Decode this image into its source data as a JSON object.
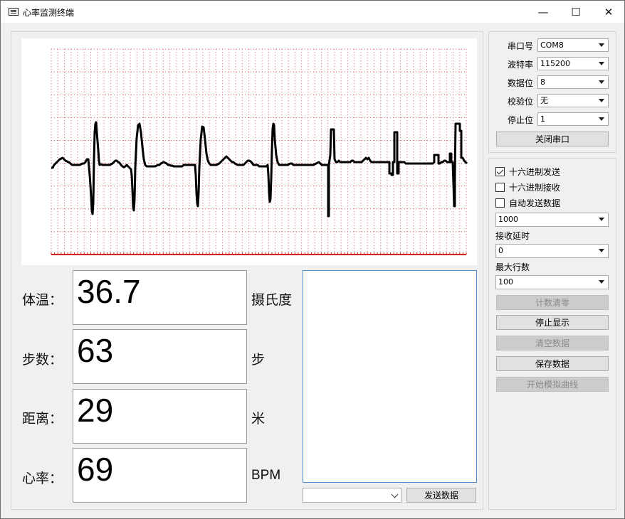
{
  "window": {
    "title": "心率监测终端",
    "minimize_glyph": "—",
    "maximize_glyph": "☐",
    "close_glyph": "✕"
  },
  "plot": {
    "ecg_points": [
      [
        0,
        190
      ],
      [
        2,
        190
      ],
      [
        4,
        186
      ],
      [
        6,
        184
      ],
      [
        8,
        182
      ],
      [
        10,
        180
      ],
      [
        12,
        178
      ],
      [
        14,
        177
      ],
      [
        16,
        176
      ],
      [
        18,
        178
      ],
      [
        20,
        180
      ],
      [
        22,
        181
      ],
      [
        24,
        182
      ],
      [
        26,
        183
      ],
      [
        28,
        185
      ],
      [
        30,
        186
      ],
      [
        32,
        186
      ],
      [
        34,
        186
      ],
      [
        36,
        186
      ],
      [
        38,
        186
      ],
      [
        40,
        186
      ],
      [
        42,
        185
      ],
      [
        44,
        184
      ],
      [
        46,
        184
      ],
      [
        48,
        182
      ],
      [
        50,
        178
      ],
      [
        52,
        178
      ],
      [
        54,
        200
      ],
      [
        56,
        230
      ],
      [
        57,
        250
      ],
      [
        58,
        255
      ],
      [
        59,
        240
      ],
      [
        60,
        180
      ],
      [
        61,
        140
      ],
      [
        62,
        128
      ],
      [
        63,
        126
      ],
      [
        64,
        140
      ],
      [
        66,
        165
      ],
      [
        67,
        180
      ],
      [
        68,
        186
      ],
      [
        70,
        185
      ],
      [
        72,
        186
      ],
      [
        74,
        186
      ],
      [
        76,
        186
      ],
      [
        78,
        186
      ],
      [
        80,
        186
      ],
      [
        82,
        186
      ],
      [
        84,
        185
      ],
      [
        86,
        184
      ],
      [
        88,
        182
      ],
      [
        90,
        180
      ],
      [
        92,
        180
      ],
      [
        94,
        182
      ],
      [
        96,
        183
      ],
      [
        98,
        186
      ],
      [
        100,
        188
      ],
      [
        102,
        189
      ],
      [
        104,
        188
      ],
      [
        106,
        186
      ],
      [
        108,
        188
      ],
      [
        110,
        190
      ],
      [
        112,
        192
      ],
      [
        113,
        200
      ],
      [
        114,
        220
      ],
      [
        115,
        245
      ],
      [
        116,
        250
      ],
      [
        117,
        235
      ],
      [
        118,
        190
      ],
      [
        120,
        148
      ],
      [
        122,
        130
      ],
      [
        124,
        128
      ],
      [
        126,
        140
      ],
      [
        128,
        160
      ],
      [
        130,
        178
      ],
      [
        132,
        186
      ],
      [
        134,
        188
      ],
      [
        136,
        188
      ],
      [
        138,
        188
      ],
      [
        140,
        188
      ],
      [
        142,
        188
      ],
      [
        144,
        188
      ],
      [
        146,
        188
      ],
      [
        148,
        187
      ],
      [
        150,
        186
      ],
      [
        152,
        186
      ],
      [
        154,
        184
      ],
      [
        156,
        183
      ],
      [
        158,
        182
      ],
      [
        160,
        183
      ],
      [
        162,
        184
      ],
      [
        164,
        186
      ],
      [
        166,
        186
      ],
      [
        168,
        187
      ],
      [
        170,
        187
      ],
      [
        172,
        188
      ],
      [
        174,
        188
      ],
      [
        176,
        188
      ],
      [
        178,
        188
      ],
      [
        180,
        188
      ],
      [
        182,
        188
      ],
      [
        184,
        188
      ],
      [
        186,
        186
      ],
      [
        188,
        186
      ],
      [
        190,
        186
      ],
      [
        192,
        186
      ],
      [
        194,
        186
      ],
      [
        196,
        186
      ],
      [
        198,
        186
      ],
      [
        200,
        186
      ],
      [
        202,
        186
      ],
      [
        203,
        200
      ],
      [
        204,
        225
      ],
      [
        205,
        240
      ],
      [
        206,
        244
      ],
      [
        207,
        225
      ],
      [
        208,
        190
      ],
      [
        210,
        150
      ],
      [
        212,
        132
      ],
      [
        214,
        133
      ],
      [
        216,
        150
      ],
      [
        218,
        170
      ],
      [
        220,
        180
      ],
      [
        222,
        184
      ],
      [
        224,
        186
      ],
      [
        226,
        186
      ],
      [
        228,
        186
      ],
      [
        230,
        186
      ],
      [
        232,
        186
      ],
      [
        234,
        185
      ],
      [
        236,
        184
      ],
      [
        238,
        182
      ],
      [
        240,
        180
      ],
      [
        242,
        178
      ],
      [
        244,
        176
      ],
      [
        246,
        174
      ],
      [
        248,
        176
      ],
      [
        250,
        178
      ],
      [
        252,
        180
      ],
      [
        254,
        182
      ],
      [
        256,
        182
      ],
      [
        258,
        184
      ],
      [
        260,
        185
      ],
      [
        262,
        186
      ],
      [
        264,
        186
      ],
      [
        266,
        186
      ],
      [
        268,
        186
      ],
      [
        270,
        186
      ],
      [
        272,
        184
      ],
      [
        274,
        182
      ],
      [
        276,
        180
      ],
      [
        278,
        180
      ],
      [
        280,
        181
      ],
      [
        282,
        183
      ],
      [
        284,
        186
      ],
      [
        286,
        186
      ],
      [
        288,
        186
      ],
      [
        290,
        186
      ],
      [
        292,
        188
      ],
      [
        294,
        188
      ],
      [
        296,
        188
      ],
      [
        298,
        188
      ],
      [
        300,
        188
      ],
      [
        302,
        188
      ],
      [
        304,
        186
      ],
      [
        305,
        200
      ],
      [
        306,
        225
      ],
      [
        307,
        238
      ],
      [
        308,
        234
      ],
      [
        309,
        205
      ],
      [
        310,
        165
      ],
      [
        311,
        135
      ],
      [
        312,
        128
      ],
      [
        313,
        130
      ],
      [
        314,
        150
      ],
      [
        316,
        172
      ],
      [
        318,
        182
      ],
      [
        320,
        186
      ],
      [
        322,
        186
      ],
      [
        324,
        186
      ],
      [
        326,
        186
      ],
      [
        328,
        186
      ],
      [
        330,
        186
      ],
      [
        332,
        186
      ],
      [
        334,
        185
      ],
      [
        336,
        184
      ],
      [
        338,
        184
      ],
      [
        340,
        186
      ],
      [
        342,
        186
      ],
      [
        344,
        186
      ],
      [
        346,
        186
      ],
      [
        348,
        186
      ],
      [
        350,
        186
      ],
      [
        352,
        186
      ],
      [
        354,
        186
      ],
      [
        356,
        186
      ],
      [
        358,
        186
      ],
      [
        360,
        186
      ],
      [
        362,
        186
      ],
      [
        364,
        186
      ],
      [
        366,
        186
      ],
      [
        368,
        186
      ],
      [
        370,
        185
      ],
      [
        372,
        184
      ],
      [
        374,
        183
      ],
      [
        376,
        182
      ],
      [
        378,
        184
      ],
      [
        380,
        186
      ],
      [
        382,
        186
      ],
      [
        384,
        186
      ],
      [
        386,
        186
      ],
      [
        388,
        186
      ],
      [
        389,
        186
      ],
      [
        389,
        258
      ],
      [
        390,
        258
      ],
      [
        390,
        186
      ],
      [
        392,
        172
      ],
      [
        393,
        136
      ],
      [
        397,
        136
      ],
      [
        398,
        178
      ],
      [
        400,
        182
      ],
      [
        402,
        182
      ],
      [
        404,
        180
      ],
      [
        406,
        182
      ],
      [
        408,
        182
      ],
      [
        410,
        182
      ],
      [
        412,
        182
      ],
      [
        414,
        182
      ],
      [
        416,
        182
      ],
      [
        418,
        182
      ],
      [
        420,
        182
      ],
      [
        422,
        180
      ],
      [
        424,
        180
      ],
      [
        426,
        182
      ],
      [
        428,
        182
      ],
      [
        430,
        182
      ],
      [
        432,
        182
      ],
      [
        434,
        182
      ],
      [
        436,
        182
      ],
      [
        438,
        180
      ],
      [
        440,
        178
      ],
      [
        442,
        176
      ],
      [
        444,
        178
      ],
      [
        446,
        176
      ],
      [
        448,
        180
      ],
      [
        450,
        182
      ],
      [
        452,
        182
      ],
      [
        454,
        182
      ],
      [
        456,
        182
      ],
      [
        458,
        182
      ],
      [
        460,
        182
      ],
      [
        462,
        182
      ],
      [
        464,
        182
      ],
      [
        466,
        182
      ],
      [
        468,
        182
      ],
      [
        470,
        182
      ],
      [
        472,
        182
      ],
      [
        474,
        182
      ],
      [
        475,
        182
      ],
      [
        475,
        198
      ],
      [
        478,
        198
      ],
      [
        478,
        200
      ],
      [
        480,
        200
      ],
      [
        480,
        182
      ],
      [
        482,
        182
      ],
      [
        482,
        140
      ],
      [
        486,
        140
      ],
      [
        486,
        198
      ],
      [
        488,
        198
      ],
      [
        488,
        182
      ],
      [
        490,
        182
      ],
      [
        492,
        182
      ],
      [
        494,
        182
      ],
      [
        496,
        182
      ],
      [
        498,
        184
      ],
      [
        500,
        184
      ],
      [
        502,
        184
      ],
      [
        504,
        184
      ],
      [
        506,
        184
      ],
      [
        508,
        184
      ],
      [
        510,
        184
      ],
      [
        512,
        184
      ],
      [
        514,
        184
      ],
      [
        516,
        184
      ],
      [
        518,
        184
      ],
      [
        520,
        184
      ],
      [
        522,
        184
      ],
      [
        524,
        184
      ],
      [
        526,
        184
      ],
      [
        528,
        184
      ],
      [
        530,
        184
      ],
      [
        532,
        184
      ],
      [
        534,
        184
      ],
      [
        536,
        184
      ],
      [
        538,
        182
      ],
      [
        538,
        172
      ],
      [
        544,
        172
      ],
      [
        544,
        184
      ],
      [
        546,
        184
      ],
      [
        548,
        182
      ],
      [
        550,
        182
      ],
      [
        552,
        180
      ],
      [
        554,
        180
      ],
      [
        556,
        182
      ],
      [
        558,
        182
      ],
      [
        560,
        182
      ],
      [
        560,
        170
      ],
      [
        562,
        170
      ],
      [
        562,
        182
      ],
      [
        564,
        182
      ],
      [
        566,
        244
      ],
      [
        567,
        244
      ],
      [
        567,
        200
      ],
      [
        568,
        128
      ],
      [
        574,
        128
      ],
      [
        574,
        138
      ],
      [
        576,
        138
      ],
      [
        576,
        176
      ],
      [
        578,
        176
      ],
      [
        580,
        180
      ],
      [
        582,
        182
      ],
      [
        584,
        184
      ]
    ]
  },
  "metrics": [
    {
      "label": "体温：",
      "value": "36.7",
      "unit": "摄氏度"
    },
    {
      "label": "步数：",
      "value": "63",
      "unit": "步"
    },
    {
      "label": "距离：",
      "value": "29",
      "unit": "米"
    },
    {
      "label": "心率：",
      "value": "69",
      "unit": "BPM"
    }
  ],
  "serial": {
    "port_label": "串口号",
    "port_value": "COM8",
    "baud_label": "波特率",
    "baud_value": "115200",
    "databits_label": "数据位",
    "databits_value": "8",
    "parity_label": "校验位",
    "parity_value": "无",
    "stopbits_label": "停止位",
    "stopbits_value": "1",
    "close_port_label": "关闭串口"
  },
  "options": {
    "hex_send_label": "十六进制发送",
    "hex_send_checked": true,
    "hex_recv_label": "十六进制接收",
    "hex_recv_checked": false,
    "auto_send_label": "自动发送数据",
    "auto_send_checked": false,
    "interval_value": "1000",
    "recv_delay_label": "接收延时",
    "recv_delay_value": "0",
    "max_lines_label": "最大行数",
    "max_lines_value": "100"
  },
  "buttons": {
    "clear_count": "计数清零",
    "stop_display": "停止显示",
    "clear_data": "清空数据",
    "save_data": "保存数据",
    "start_sim": "开始模拟曲线",
    "send_data": "发送数据"
  },
  "send": {
    "value": ""
  }
}
